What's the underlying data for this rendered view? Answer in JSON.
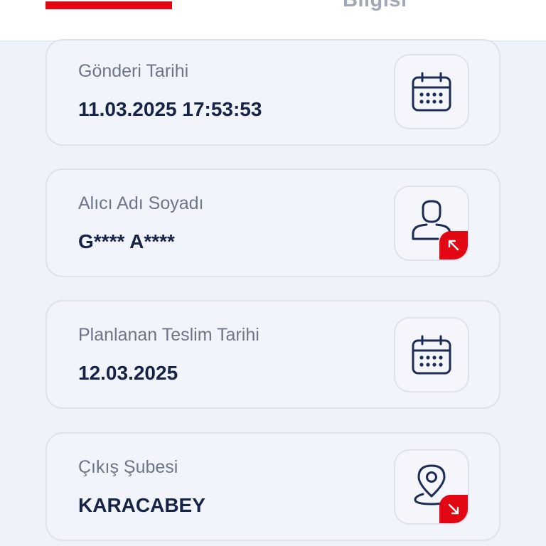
{
  "theme": {
    "accent": "#e30613",
    "icon_color": "#1d2b57"
  },
  "tabs": {
    "second_label": "Bilgisi"
  },
  "cards": [
    {
      "label": "Gönderi Tarihi",
      "value": "11.03.2025 17:53:53",
      "icon": "calendar-icon"
    },
    {
      "label": "Alıcı Adı Soyadı",
      "value": "G**** A****",
      "icon": "user-icon",
      "badge_icon": "arrow-up-left-icon"
    },
    {
      "label": "Planlanan Teslim Tarihi",
      "value": "12.03.2025",
      "icon": "calendar-icon"
    },
    {
      "label": "Çıkış Şubesi",
      "value": "KARACABEY",
      "icon": "location-pin-icon",
      "badge_icon": "arrow-down-right-icon"
    }
  ]
}
